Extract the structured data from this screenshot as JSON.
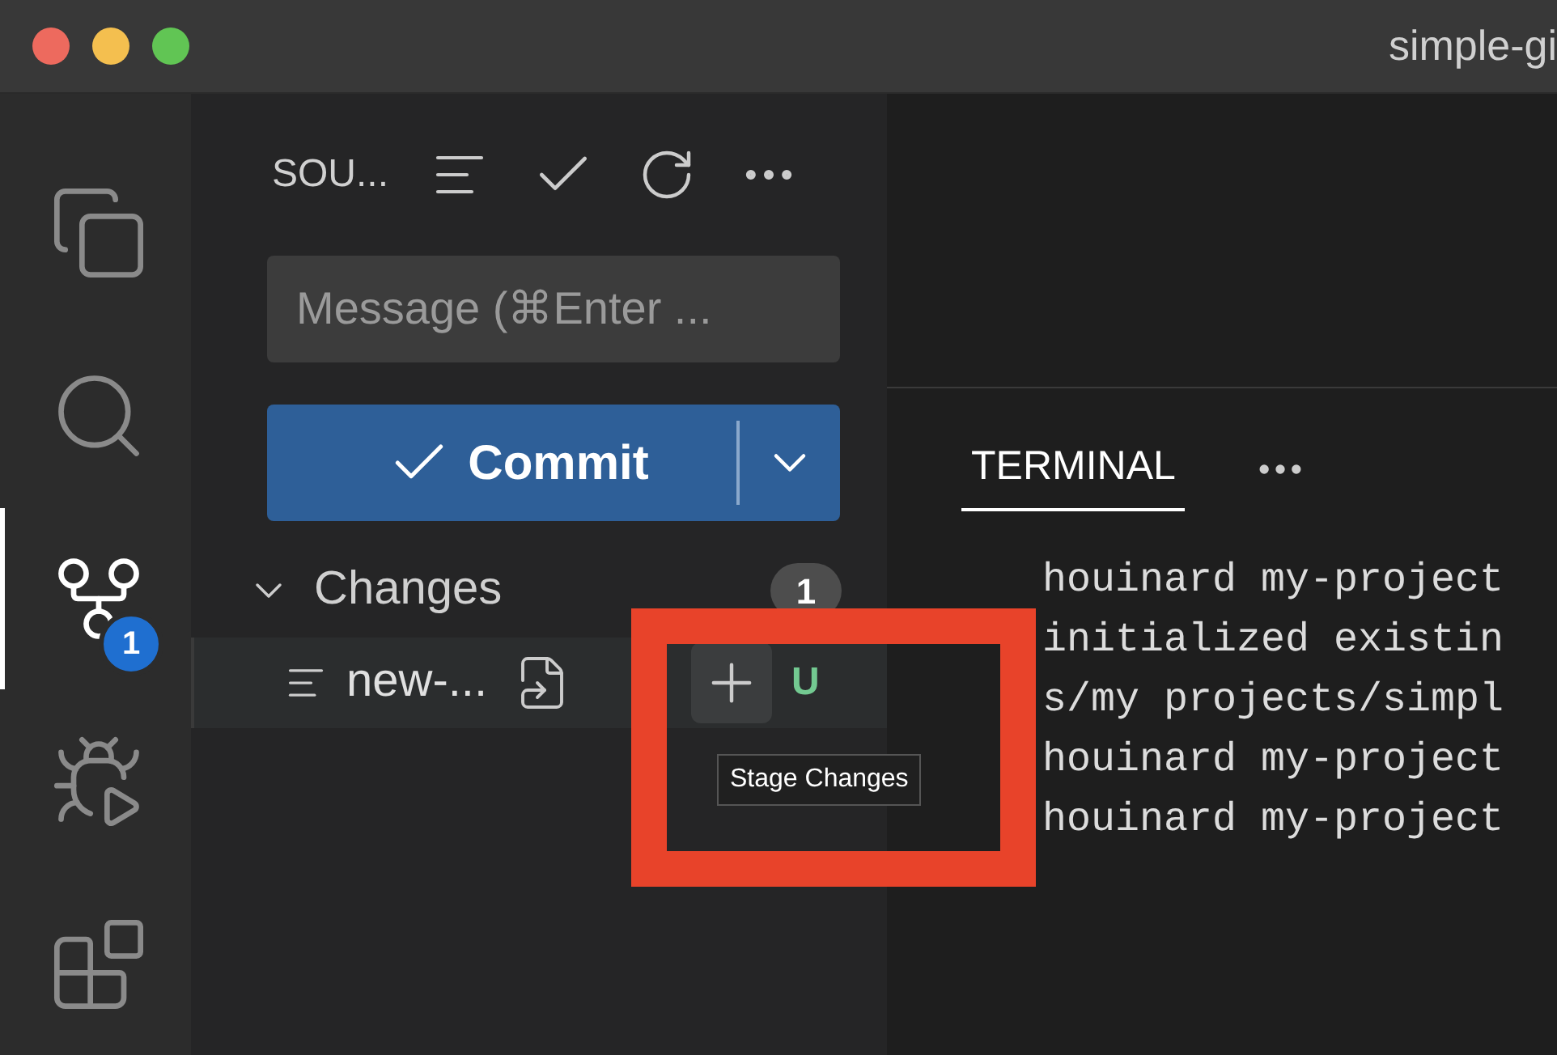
{
  "window": {
    "title": "simple-gi"
  },
  "activity_bar": [
    {
      "kind": "files",
      "selected": false
    },
    {
      "kind": "search",
      "selected": false
    },
    {
      "kind": "scm",
      "selected": true,
      "badge": "1"
    },
    {
      "kind": "debug",
      "selected": false
    },
    {
      "kind": "extensions",
      "selected": false
    }
  ],
  "source_control": {
    "title": "SOU...",
    "message": {
      "placeholder": "Message (⌘Enter ..."
    },
    "commit_button": "Commit",
    "changes": {
      "label": "Changes",
      "expanded": true,
      "count": "1",
      "files": [
        {
          "name": "new-...",
          "status": "U"
        }
      ]
    }
  },
  "tooltip": "Stage Changes",
  "panel": {
    "tabs": [
      {
        "label": "TERMINAL",
        "selected": true
      }
    ],
    "terminal_lines": [
      "houinard my-project",
      "initialized existin",
      "s/my projects/simpl",
      "houinard my-project",
      "houinard my-project"
    ]
  }
}
